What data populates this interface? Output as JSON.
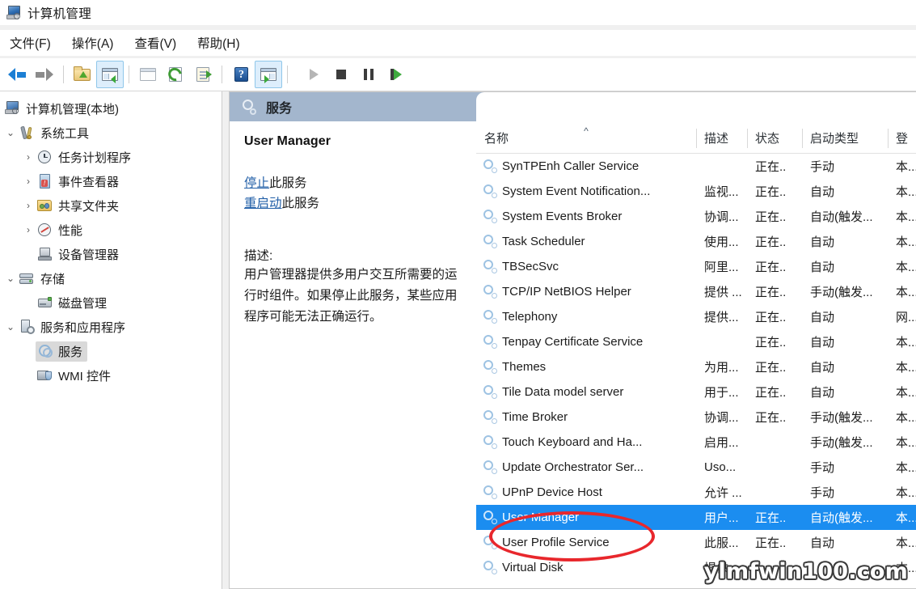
{
  "window": {
    "title": "计算机管理",
    "icon": "computer-management-icon"
  },
  "menu": {
    "items": [
      {
        "label": "文件(F)"
      },
      {
        "label": "操作(A)"
      },
      {
        "label": "查看(V)"
      },
      {
        "label": "帮助(H)"
      }
    ]
  },
  "toolbar": {
    "buttons": [
      {
        "name": "back-button",
        "icon": "back-arrow-icon"
      },
      {
        "name": "forward-button",
        "icon": "forward-arrow-icon"
      },
      {
        "name": "up-one-level-button",
        "icon": "folder-up-icon"
      },
      {
        "name": "show-hide-console-tree-button",
        "icon": "console-tree-icon"
      },
      {
        "name": "properties-button",
        "icon": "properties-icon"
      },
      {
        "name": "refresh-button",
        "icon": "refresh-icon"
      },
      {
        "name": "export-list-button",
        "icon": "export-list-icon"
      },
      {
        "name": "help-button",
        "icon": "help-icon"
      },
      {
        "name": "show-action-pane-button",
        "icon": "action-pane-icon"
      },
      {
        "name": "start-service-button",
        "icon": "play-icon"
      },
      {
        "name": "stop-service-button",
        "icon": "stop-icon"
      },
      {
        "name": "pause-service-button",
        "icon": "pause-icon"
      },
      {
        "name": "restart-service-button",
        "icon": "restart-icon"
      }
    ]
  },
  "tree": {
    "nodes": [
      {
        "label": "计算机管理(本地)",
        "indent": 0,
        "chevron": "",
        "icon": "computer-icon",
        "selected": false
      },
      {
        "label": "系统工具",
        "indent": 1,
        "chevron": "expanded",
        "icon": "system-tools-icon",
        "selected": false
      },
      {
        "label": "任务计划程序",
        "indent": 2,
        "chevron": "collapsed",
        "icon": "task-scheduler-icon",
        "selected": false
      },
      {
        "label": "事件查看器",
        "indent": 2,
        "chevron": "collapsed",
        "icon": "event-viewer-icon",
        "selected": false
      },
      {
        "label": "共享文件夹",
        "indent": 2,
        "chevron": "collapsed",
        "icon": "shared-folders-icon",
        "selected": false
      },
      {
        "label": "性能",
        "indent": 2,
        "chevron": "collapsed",
        "icon": "performance-icon",
        "selected": false
      },
      {
        "label": "设备管理器",
        "indent": 2,
        "chevron": "",
        "icon": "device-manager-icon",
        "selected": false
      },
      {
        "label": "存储",
        "indent": 1,
        "chevron": "expanded",
        "icon": "storage-icon",
        "selected": false
      },
      {
        "label": "磁盘管理",
        "indent": 2,
        "chevron": "",
        "icon": "disk-management-icon",
        "selected": false
      },
      {
        "label": "服务和应用程序",
        "indent": 1,
        "chevron": "expanded",
        "icon": "services-and-applications-icon",
        "selected": false
      },
      {
        "label": "服务",
        "indent": 2,
        "chevron": "",
        "icon": "services-icon",
        "selected": true
      },
      {
        "label": "WMI 控件",
        "indent": 2,
        "chevron": "",
        "icon": "wmi-control-icon",
        "selected": false
      }
    ]
  },
  "results": {
    "header_title": "服务",
    "header_icon": "services-gear-icon"
  },
  "detail": {
    "service_name": "User Manager",
    "stop_link": "停止",
    "stop_suffix": "此服务",
    "restart_link": "重启动",
    "restart_suffix": "此服务",
    "description_label": "描述:",
    "description_body": "用户管理器提供多用户交互所需要的运行时组件。如果停止此服务，某些应用程序可能无法正确运行。"
  },
  "list": {
    "columns": [
      {
        "label": "名称",
        "sort": "asc"
      },
      {
        "label": "描述",
        "sort": ""
      },
      {
        "label": "状态",
        "sort": ""
      },
      {
        "label": "启动类型",
        "sort": ""
      },
      {
        "label": "登",
        "sort": ""
      }
    ],
    "sort_caret": "^",
    "rows": [
      {
        "name": "SynTPEnh Caller Service",
        "desc": "",
        "state": "正在..",
        "start": "手动",
        "logon": "本...",
        "selected": false
      },
      {
        "name": "System Event Notification...",
        "desc": "监视...",
        "state": "正在..",
        "start": "自动",
        "logon": "本...",
        "selected": false
      },
      {
        "name": "System Events Broker",
        "desc": "协调...",
        "state": "正在..",
        "start": "自动(触发...",
        "logon": "本...",
        "selected": false
      },
      {
        "name": "Task Scheduler",
        "desc": "使用...",
        "state": "正在..",
        "start": "自动",
        "logon": "本...",
        "selected": false
      },
      {
        "name": "TBSecSvc",
        "desc": "阿里...",
        "state": "正在..",
        "start": "自动",
        "logon": "本...",
        "selected": false
      },
      {
        "name": "TCP/IP NetBIOS Helper",
        "desc": "提供 ...",
        "state": "正在..",
        "start": "手动(触发...",
        "logon": "本...",
        "selected": false
      },
      {
        "name": "Telephony",
        "desc": "提供...",
        "state": "正在..",
        "start": "自动",
        "logon": "网...",
        "selected": false
      },
      {
        "name": "Tenpay Certificate Service",
        "desc": "",
        "state": "正在..",
        "start": "自动",
        "logon": "本...",
        "selected": false
      },
      {
        "name": "Themes",
        "desc": "为用...",
        "state": "正在..",
        "start": "自动",
        "logon": "本...",
        "selected": false
      },
      {
        "name": "Tile Data model server",
        "desc": "用于...",
        "state": "正在..",
        "start": "自动",
        "logon": "本...",
        "selected": false
      },
      {
        "name": "Time Broker",
        "desc": "协调...",
        "state": "正在..",
        "start": "手动(触发...",
        "logon": "本...",
        "selected": false
      },
      {
        "name": "Touch Keyboard and Ha...",
        "desc": "启用...",
        "state": "",
        "start": "手动(触发...",
        "logon": "本...",
        "selected": false
      },
      {
        "name": "Update Orchestrator Ser...",
        "desc": "Uso...",
        "state": "",
        "start": "手动",
        "logon": "本...",
        "selected": false
      },
      {
        "name": "UPnP Device Host",
        "desc": "允许 ...",
        "state": "",
        "start": "手动",
        "logon": "本...",
        "selected": false
      },
      {
        "name": "User Manager",
        "desc": "用户...",
        "state": "正在..",
        "start": "自动(触发...",
        "logon": "本...",
        "selected": true
      },
      {
        "name": "User Profile Service",
        "desc": "此服...",
        "state": "正在..",
        "start": "自动",
        "logon": "本...",
        "selected": false
      },
      {
        "name": "Virtual Disk",
        "desc": "提供...",
        "state": "",
        "start": "",
        "logon": "本...",
        "selected": false
      }
    ]
  },
  "annotation": {
    "type": "red-ellipse",
    "target": "User Manager",
    "color": "#e8272c"
  },
  "watermark": {
    "text": "ylmfwin100.com"
  }
}
